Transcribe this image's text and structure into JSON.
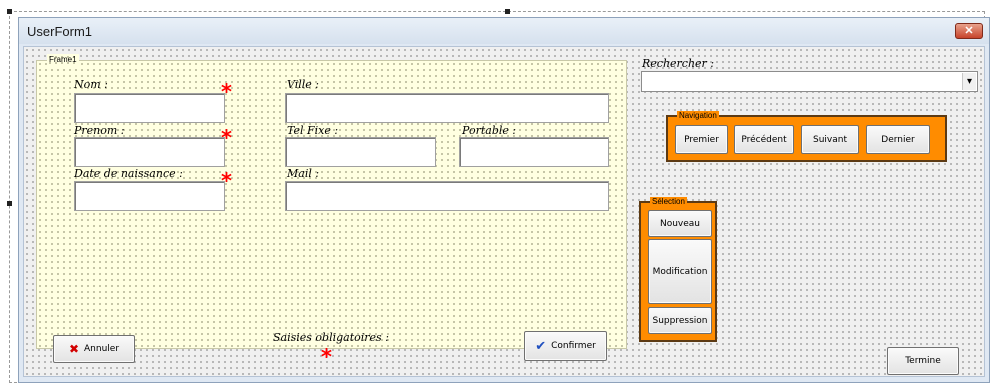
{
  "window": {
    "title": "UserForm1",
    "close_glyph": "✕"
  },
  "frame1": {
    "caption": "Frame1",
    "labels": {
      "nom": "Nom :",
      "prenom": "Prenom :",
      "date": "Date de naissance :",
      "ville": "Ville :",
      "tel": "Tel Fixe :",
      "portable": "Portable :",
      "mail": "Mail :",
      "saisies": "Saisies obligatoires :"
    },
    "required_mark": "*",
    "annuler_label": "Annuler",
    "annuler_icon": "✖",
    "confirmer_label": "Confirmer",
    "confirmer_icon": "✔"
  },
  "search": {
    "label": "Rechercher :",
    "value": "",
    "dropdown_glyph": "▾"
  },
  "navigation": {
    "caption": "Navigation",
    "buttons": [
      "Premier",
      "Précédent",
      "Suivant",
      "Dernier"
    ]
  },
  "selection": {
    "caption": "Sélection",
    "buttons": [
      "Nouveau",
      "Modification",
      "Suppression"
    ]
  },
  "termine_label": "Termine",
  "colors": {
    "frame_bg": "#ffffe1",
    "accent_orange": "#ff8c00",
    "required_red": "#ff0000",
    "confirm_check": "#1f4fbf",
    "cancel_x": "#d20000"
  }
}
